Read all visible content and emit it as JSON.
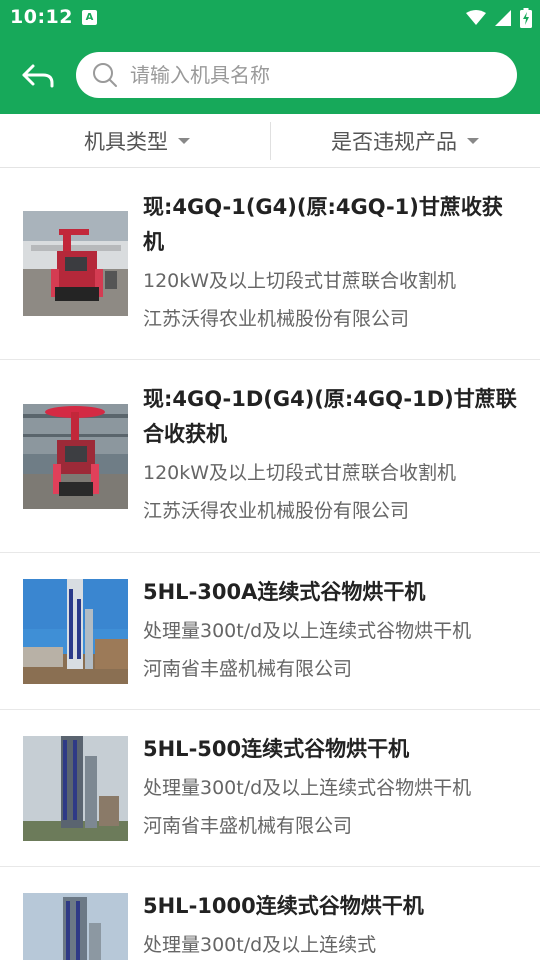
{
  "status_bar": {
    "time": "10:12",
    "app_badge": "A",
    "icons": [
      "wifi-icon",
      "cellular-signal-icon",
      "battery-charging-icon"
    ]
  },
  "header": {
    "back_icon": "back-arrow-icon",
    "search_placeholder": "请输入机具名称",
    "search_icon": "search-icon"
  },
  "filters": [
    {
      "label": "机具类型",
      "icon": "dropdown-caret-icon"
    },
    {
      "label": "是否违规产品",
      "icon": "dropdown-caret-icon"
    }
  ],
  "products": [
    {
      "title": "现:4GQ-1(G4)(原:4GQ-1)甘蔗收获机",
      "description": "120kW及以上切段式甘蔗联合收割机",
      "company": "江苏沃得农业机械股份有限公司",
      "image": "sugarcane-harvester-photo"
    },
    {
      "title": "现:4GQ-1D(G4)(原:4GQ-1D)甘蔗联合收获机",
      "description": "120kW及以上切段式甘蔗联合收割机",
      "company": "江苏沃得农业机械股份有限公司",
      "image": "sugarcane-harvester-photo"
    },
    {
      "title": "5HL-300A连续式谷物烘干机",
      "description": "处理量300t/d及以上连续式谷物烘干机",
      "company": "河南省丰盛机械有限公司",
      "image": "grain-dryer-tower-photo"
    },
    {
      "title": "5HL-500连续式谷物烘干机",
      "description": "处理量300t/d及以上连续式谷物烘干机",
      "company": "河南省丰盛机械有限公司",
      "image": "grain-dryer-tower-photo"
    },
    {
      "title": "5HL-1000连续式谷物烘干机",
      "description": "处理量300t/d及以上连续式",
      "company": "",
      "image": "grain-dryer-tower-photo"
    }
  ],
  "colors": {
    "brand_green": "#17a95a",
    "title_text": "#222222",
    "secondary_text": "#666666"
  }
}
